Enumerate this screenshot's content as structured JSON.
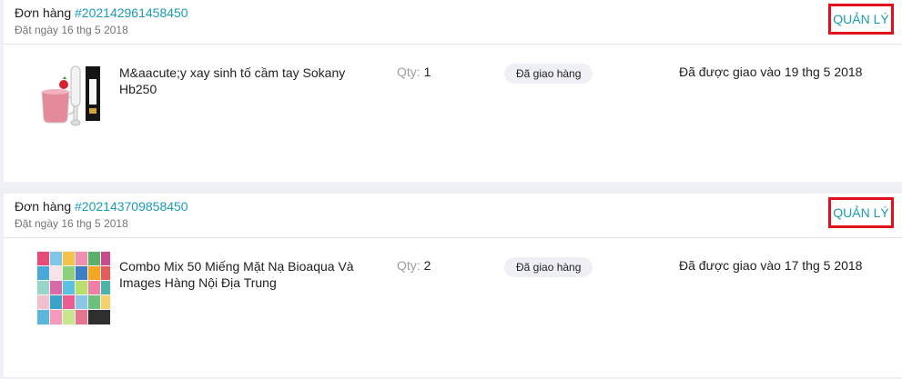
{
  "orders": [
    {
      "title_prefix": "Đơn hàng",
      "number": "#202142961458450",
      "date": "Đặt ngày 16 thg 5 2018",
      "manage_label": "QUẢN LÝ",
      "product_name": "M&aacute;y xay sinh tố cầm tay Sokany Hb250",
      "qty_label": "Qty:",
      "qty": "1",
      "status": "Đã giao hàng",
      "delivered": "Đã được giao vào 19 thg 5 2018",
      "thumb_icon": "blender-product-image"
    },
    {
      "title_prefix": "Đơn hàng",
      "number": "#202143709858450",
      "date": "Đặt ngày 16 thg 5 2018",
      "manage_label": "QUẢN LÝ",
      "product_name": "Combo Mix 50 Miếng Mặt Nạ Bioaqua Và Images Hàng Nội Địa Trung",
      "qty_label": "Qty:",
      "qty": "2",
      "status": "Đã giao hàng",
      "delivered": "Đã được giao vào 17 thg 5 2018",
      "thumb_icon": "face-mask-product-image"
    }
  ],
  "colors": {
    "accent": "#1a9cb7",
    "highlight_border": "#e3101c",
    "page_bg": "#eff0f5"
  }
}
